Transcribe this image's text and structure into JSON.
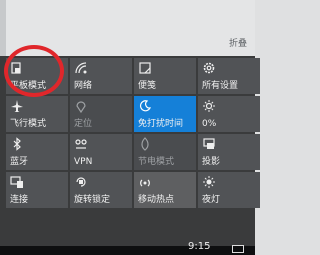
{
  "header": {
    "collapse_label": "折叠"
  },
  "tiles": [
    {
      "label": "平板模式",
      "icon": "tablet-mode-icon",
      "state": "normal"
    },
    {
      "label": "网络",
      "icon": "network-icon",
      "state": "normal"
    },
    {
      "label": "便笺",
      "icon": "note-icon",
      "state": "normal"
    },
    {
      "label": "所有设置",
      "icon": "gear-icon",
      "state": "normal"
    },
    {
      "label": "飞行模式",
      "icon": "airplane-icon",
      "state": "normal"
    },
    {
      "label": "定位",
      "icon": "location-icon",
      "state": "off"
    },
    {
      "label": "免打扰时间",
      "icon": "moon-icon",
      "state": "on"
    },
    {
      "label": "0%",
      "icon": "brightness-icon",
      "state": "normal"
    },
    {
      "label": "蓝牙",
      "icon": "bluetooth-icon",
      "state": "normal"
    },
    {
      "label": "VPN",
      "icon": "vpn-icon",
      "state": "normal"
    },
    {
      "label": "节电模式",
      "icon": "battery-saver-icon",
      "state": "off"
    },
    {
      "label": "投影",
      "icon": "project-icon",
      "state": "normal"
    },
    {
      "label": "连接",
      "icon": "connect-icon",
      "state": "normal"
    },
    {
      "label": "旋转锁定",
      "icon": "rotation-lock-icon",
      "state": "normal"
    },
    {
      "label": "移动热点",
      "icon": "hotspot-icon",
      "state": "half"
    },
    {
      "label": "夜灯",
      "icon": "night-light-icon",
      "state": "normal"
    }
  ],
  "taskbar": {
    "clock": "9:15"
  },
  "colors": {
    "accent": "#1580d8",
    "annotation": "#e0272b"
  }
}
